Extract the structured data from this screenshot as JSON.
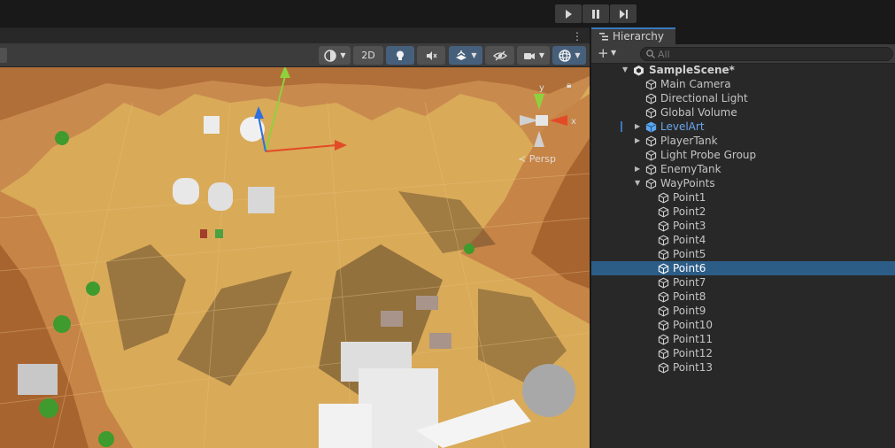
{
  "play_controls": {
    "play": "play-icon",
    "pause": "pause-icon",
    "step": "step-icon"
  },
  "scene_view": {
    "toolbar": {
      "mode_2d": "2D",
      "scene_lighting": "light-bulb-icon",
      "scene_audio": "audio-muted-icon",
      "effects": "effects-icon",
      "hidden_objects": "visibility-off-icon",
      "camera": "camera-icon",
      "gizmos": "gizmo-sphere-icon"
    },
    "orientation_gizmo": {
      "y_label": "y",
      "x_label": "x",
      "projection": "≺ Persp"
    }
  },
  "hierarchy": {
    "tab_title": "Hierarchy",
    "search": {
      "placeholder": "All"
    },
    "scene_name": "SampleScene*",
    "items": [
      {
        "label": "Main Camera"
      },
      {
        "label": "Directional Light"
      },
      {
        "label": "Global Volume"
      },
      {
        "label": "LevelArt"
      },
      {
        "label": "PlayerTank"
      },
      {
        "label": "Light Probe Group"
      },
      {
        "label": "EnemyTank"
      },
      {
        "label": "WayPoints"
      }
    ],
    "waypoints": [
      {
        "label": "Point1"
      },
      {
        "label": "Point2"
      },
      {
        "label": "Point3"
      },
      {
        "label": "Point4"
      },
      {
        "label": "Point5"
      },
      {
        "label": "Point6"
      },
      {
        "label": "Point7"
      },
      {
        "label": "Point8"
      },
      {
        "label": "Point9"
      },
      {
        "label": "Point10"
      },
      {
        "label": "Point11"
      },
      {
        "label": "Point12"
      },
      {
        "label": "Point13"
      }
    ],
    "selected": "Point6"
  },
  "colors": {
    "selection": "#2c5d87",
    "prefab_text": "#6aa6ee",
    "active_toggle": "#46607c",
    "sand": "#d7a856",
    "rock": "#c98a4e"
  }
}
